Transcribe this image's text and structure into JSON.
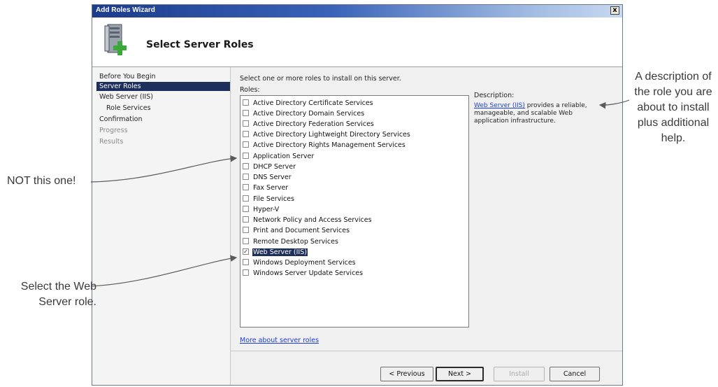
{
  "window": {
    "title": "Add Roles Wizard",
    "close_glyph": "x",
    "header_title": "Select Server Roles",
    "header_icon": "server-roles-icon"
  },
  "nav": {
    "items": [
      {
        "label": "Before You Begin",
        "state": "normal"
      },
      {
        "label": "Server Roles",
        "state": "active"
      },
      {
        "label": "Web Server (IIS)",
        "state": "normal"
      },
      {
        "label": "Role Services",
        "state": "sub"
      },
      {
        "label": "Confirmation",
        "state": "normal"
      },
      {
        "label": "Progress",
        "state": "disabled"
      },
      {
        "label": "Results",
        "state": "disabled"
      }
    ]
  },
  "main": {
    "instruction": "Select one or more roles to install on this server.",
    "roles_label": "Roles:",
    "roles": [
      {
        "label": "Active Directory Certificate Services",
        "checked": false
      },
      {
        "label": "Active Directory Domain Services",
        "checked": false
      },
      {
        "label": "Active Directory Federation Services",
        "checked": false
      },
      {
        "label": "Active Directory Lightweight Directory Services",
        "checked": false
      },
      {
        "label": "Active Directory Rights Management Services",
        "checked": false
      },
      {
        "label": "Application Server",
        "checked": false
      },
      {
        "label": "DHCP Server",
        "checked": false
      },
      {
        "label": "DNS Server",
        "checked": false
      },
      {
        "label": "Fax Server",
        "checked": false
      },
      {
        "label": "File Services",
        "checked": false
      },
      {
        "label": "Hyper-V",
        "checked": false
      },
      {
        "label": "Network Policy and Access Services",
        "checked": false
      },
      {
        "label": "Print and Document Services",
        "checked": false
      },
      {
        "label": "Remote Desktop Services",
        "checked": false
      },
      {
        "label": "Web Server (IIS)",
        "checked": true
      },
      {
        "label": "Windows Deployment Services",
        "checked": false
      },
      {
        "label": "Windows Server Update Services",
        "checked": false
      }
    ],
    "description_label": "Description:",
    "description_link": "Web Server (IIS)",
    "description_text": " provides a reliable, manageable, and scalable Web application infrastructure.",
    "more_link": "More about server roles"
  },
  "buttons": {
    "previous": "< Previous",
    "next": "Next >",
    "install": "Install",
    "cancel": "Cancel"
  },
  "annotations": {
    "description": "A description of the role you are about to install plus additional help.",
    "not_this": "NOT this one!",
    "select": "Select the Web Server role."
  },
  "colors": {
    "title_bar": "#1c3c8c",
    "selection": "#1e2f5c",
    "link": "#1a3fd6"
  }
}
